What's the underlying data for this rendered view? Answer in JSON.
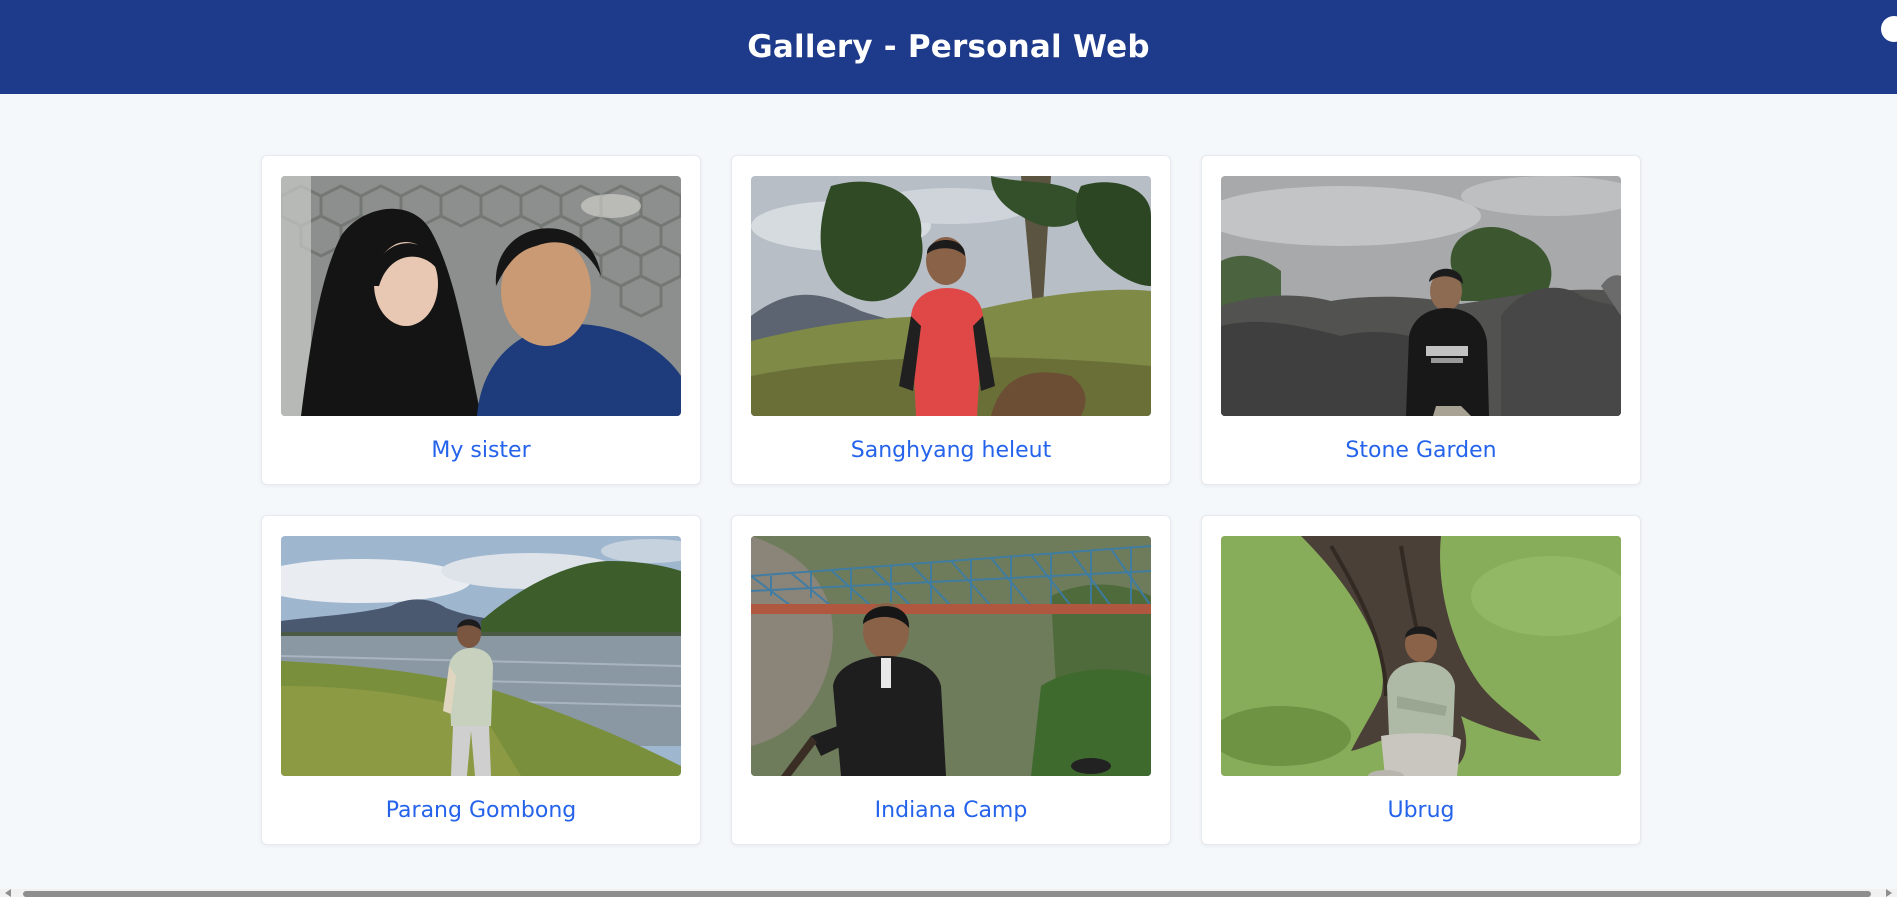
{
  "header": {
    "title": "Gallery - Personal Web"
  },
  "gallery": {
    "items": [
      {
        "caption": "My sister",
        "photo": "selfie-two-people"
      },
      {
        "caption": "Sanghyang heleut",
        "photo": "hiker-red-shirt-hills"
      },
      {
        "caption": "Stone Garden",
        "photo": "man-sitting-on-rocks"
      },
      {
        "caption": "Parang Gombong",
        "photo": "man-by-lake-and-hill"
      },
      {
        "caption": "Indiana Camp",
        "photo": "man-in-front-of-rope-bridge"
      },
      {
        "caption": "Ubrug",
        "photo": "man-sitting-under-tree"
      }
    ]
  },
  "colors": {
    "header_bg": "#1e3a8a",
    "caption_link": "#2563eb",
    "page_bg": "#f5f8fb"
  }
}
